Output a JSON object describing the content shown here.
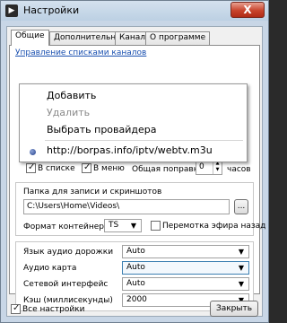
{
  "window": {
    "title": "Настройки",
    "close_label": "X",
    "icon_glyph": "▶"
  },
  "tabs": [
    "Общие",
    "Дополнительно",
    "Канал",
    "О программе"
  ],
  "channels_link": "Управление списками каналов",
  "context_menu": {
    "items": [
      {
        "label": "Добавить",
        "disabled": false
      },
      {
        "label": "Удалить",
        "disabled": true
      },
      {
        "label": "Выбрать провайдера",
        "disabled": false
      }
    ],
    "selected_url": "http://borpas.info/iptv/webtv.m3u"
  },
  "timeshift": {
    "in_list_label": "В списке",
    "in_menu_label": "В меню",
    "correction_label": "Общая поправка",
    "correction_value": "0",
    "hours_label": "часов"
  },
  "recording": {
    "folder_label": "Папка для записи и скриншотов",
    "folder_value": "C:\\Users\\Home\\Videos\\",
    "browse_label": "...",
    "container_label": "Формат контейнера",
    "container_value": "TS",
    "rewind_label": "Перемотка эфира назад"
  },
  "settings": {
    "audio_lang_label": "Язык аудио дорожки",
    "audio_lang_value": "Auto",
    "audio_card_label": "Аудио карта",
    "audio_card_value": "Auto",
    "net_iface_label": "Сетевой интерфейс",
    "net_iface_value": "Auto",
    "cache_label": "Кэш (миллисекунды)",
    "cache_value": "2000"
  },
  "footer": {
    "all_settings_label": "Все настройки",
    "close_button": "Закрыть"
  }
}
